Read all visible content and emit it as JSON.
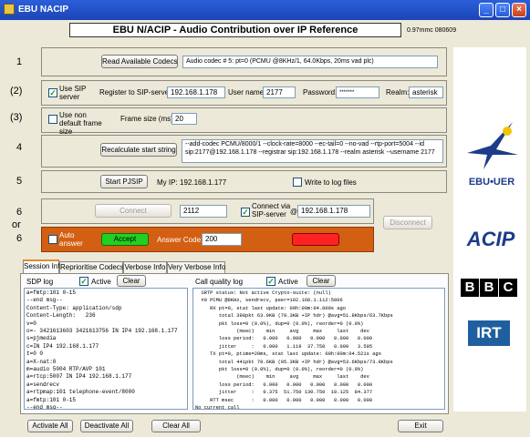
{
  "window": {
    "title": "EBU NACIP"
  },
  "header": {
    "title": "EBU N/ACIP - Audio Contribution over IP Reference",
    "version": "0.97mmc 080609"
  },
  "rows": {
    "r1": {
      "label": "1"
    },
    "r2": {
      "label": "(2)"
    },
    "r3": {
      "label": "(3)"
    },
    "r4": {
      "label": "4"
    },
    "r5": {
      "label": "5"
    },
    "r6": {
      "label_top": "6",
      "label_or": "or",
      "label_bottom": "6"
    }
  },
  "codecs": {
    "button_label": "Read Available Codecs",
    "selected": "Audio codec # 5: pt=0 (PCMU @8KHz/1, 64.0Kbps, 20ms vad plc)"
  },
  "sip": {
    "use_sip_label": "Use SIP server",
    "register_label": "Register to SIP-server:",
    "server": "192.168.1.178",
    "username_label": "User name:",
    "username": "2177",
    "password_label": "Password:",
    "password": "*******",
    "realm_label": "Realm:",
    "realm": "asterisk"
  },
  "frame": {
    "use_non_default_label": "Use non default frame size",
    "size_label": "Frame size (ms):",
    "size": "20"
  },
  "start_string": {
    "button_label": "Recalculate start string",
    "value": "--add-codec PCMU/8000/1 --clock-rate=8000 --ec-tail=0 --no-vad --rtp-port=5004 --id sip:2177@192.168.1.178 --registrar sip:192.168.1.178 --realm asterisk --username 2177"
  },
  "pjsip": {
    "start_label": "Start PJSIP",
    "my_ip_label": "My IP:",
    "my_ip": "192.168.1.177",
    "write_log_label": "Write to log files"
  },
  "connect": {
    "connect_label": "Connect",
    "target": "2112",
    "via_label": "Connect via SIP-server",
    "at": "@",
    "server": "192.168.1.178",
    "disconnect_label": "Disconnect"
  },
  "answer": {
    "auto_label": "Auto answer",
    "accept_label": "Accept",
    "code_label": "Answer Code:",
    "code": "200",
    "reject_label": "Reject"
  },
  "tabs": [
    {
      "label": "Session Info"
    },
    {
      "label": "Reprioritise Codecs"
    },
    {
      "label": "Verbose Info"
    },
    {
      "label": "Very Verbose Info"
    }
  ],
  "sdp_log": {
    "label": "SDP log",
    "active_label": "Active",
    "clear_label": "Clear",
    "lines": [
      "a=fmtp:101 0-15",
      "--end msg--",
      "Content-Type: application/sdp",
      "Content-Length:   236",
      "v=0",
      "o=- 3421613603 3421613756 IN IP4 192.168.1.177",
      "s=pjmedia",
      "c=IN IP4 192.168.1.177",
      "t=0 0",
      "a=X-nat:0",
      "m=audio 5004 RTP/AVP 101",
      "a=rtcp:5007 IN IP4 192.168.1.177",
      "a=sendrecv",
      "a=rtpmap:101 telephone-event/8000",
      "a=fmtp:101 0-15",
      "--end msg--"
    ]
  },
  "call_log": {
    "label": "Call quality log",
    "active_label": "Active",
    "clear_label": "Clear",
    "lines": [
      "  SRTP status: Not active Crypto-suite: (null)",
      "  #0 PCMU @8KHz, sendrecv, peer=192.168.1.112:5006",
      "     RX pt=0, stat last update: 00h:00m:04.000s ago",
      "        total 398pkt 63.9KB (79.3KB +IP hdr) @avg=51.8Kbps/63.7Kbps",
      "        pkt loss=0 (0.0%), dup=0 (0.0%), reorder=0 (0.0%)",
      "              (msec)    min     avg     max     last    dev",
      "        loss period:   0.000   0.000   0.000   0.000   0.000",
      "        jitter     :   0.000   1.119  37.750   0.000   3.595",
      "     TX pt=0, ptime=20ms, stat last update: 00h:00m:04.521s ago",
      "        total 441pkt 70.6KB (95.3KB +IP hdr) @avg=53.6Kbps/73.8Kbps",
      "        pkt loss=0 (0.0%), dup=0 (0.0%), reorder=0 (0.0%)",
      "              (msec)    min     avg     max     last    dev",
      "        loss period:   0.000   0.000   0.000   0.000   0.000",
      "        jitter     :   0.375  51.750 130.750  10.125  84.377",
      "     RTT msec      :   0.000   0.000   0.000   0.000   0.000",
      "No current call"
    ]
  },
  "bottom": {
    "activate_all": "Activate All",
    "deactivate_all": "Deactivate All",
    "clear_all": "Clear All",
    "exit": "Exit"
  },
  "logos": {
    "ebu": "EBU•UER",
    "acip": "ACIP",
    "bbc": [
      "B",
      "B",
      "C"
    ],
    "irt": "IRT"
  },
  "icons": {
    "minimize": "minimize-icon",
    "maximize": "maximize-icon",
    "close": "close-icon",
    "app": "app-icon"
  },
  "colors": {
    "accept": "#22d022",
    "reject": "#ff2222",
    "answer_panel": "#d35f13",
    "tab_accent": "#e68b2c",
    "ebu_blue": "#1d3c8a",
    "acip_blue": "#1b3a8c"
  }
}
